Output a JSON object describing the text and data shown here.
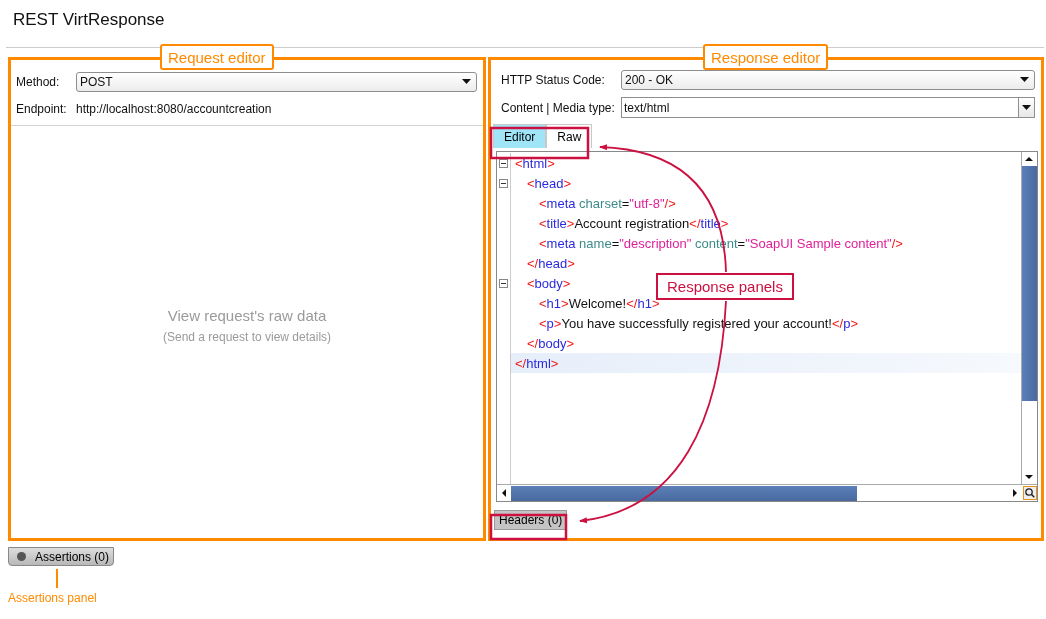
{
  "window": {
    "title": "REST VirtResponse"
  },
  "request_editor": {
    "callout": "Request editor",
    "method": {
      "label": "Method:",
      "value": "POST"
    },
    "endpoint": {
      "label": "Endpoint:",
      "value": "http://localhost:8080/accountcreation"
    },
    "empty_state": {
      "title": "View request's raw data",
      "hint": "(Send a request to view details)"
    }
  },
  "response_editor": {
    "callout": "Response editor",
    "status_code": {
      "label": "HTTP Status Code:",
      "value": "200 - OK"
    },
    "media_type": {
      "label": "Content | Media type:",
      "value": "text/html"
    },
    "tabs": [
      {
        "label": "Editor",
        "selected": true
      },
      {
        "label": "Raw",
        "selected": false
      }
    ],
    "code": [
      {
        "foldable": true,
        "current": false,
        "tokens": [
          {
            "kind": "bracket",
            "text": "<"
          },
          {
            "kind": "tag",
            "text": "html"
          },
          {
            "kind": "bracket",
            "text": ">"
          }
        ],
        "children": [
          {
            "foldable": true,
            "current": false,
            "tokens": [
              {
                "kind": "bracket",
                "text": "<"
              },
              {
                "kind": "tag",
                "text": "head"
              },
              {
                "kind": "bracket",
                "text": ">"
              }
            ],
            "children": [
              {
                "foldable": false,
                "current": false,
                "tokens": [
                  {
                    "kind": "bracket",
                    "text": "<"
                  },
                  {
                    "kind": "tag",
                    "text": "meta "
                  },
                  {
                    "kind": "attr",
                    "text": "charset"
                  },
                  {
                    "kind": "text",
                    "text": "="
                  },
                  {
                    "kind": "value",
                    "text": "\"utf-8\""
                  },
                  {
                    "kind": "bracket",
                    "text": "/>"
                  }
                ]
              },
              {
                "foldable": false,
                "current": false,
                "tokens": [
                  {
                    "kind": "bracket",
                    "text": "<"
                  },
                  {
                    "kind": "tag",
                    "text": "title"
                  },
                  {
                    "kind": "bracket",
                    "text": ">"
                  },
                  {
                    "kind": "text",
                    "text": "Account registration"
                  },
                  {
                    "kind": "bracket",
                    "text": "</"
                  },
                  {
                    "kind": "tag",
                    "text": "title"
                  },
                  {
                    "kind": "bracket",
                    "text": ">"
                  }
                ]
              },
              {
                "foldable": false,
                "current": false,
                "tokens": [
                  {
                    "kind": "bracket",
                    "text": "<"
                  },
                  {
                    "kind": "tag",
                    "text": "meta "
                  },
                  {
                    "kind": "attr",
                    "text": "name"
                  },
                  {
                    "kind": "text",
                    "text": "="
                  },
                  {
                    "kind": "value",
                    "text": "\"description\" "
                  },
                  {
                    "kind": "attr",
                    "text": "content"
                  },
                  {
                    "kind": "text",
                    "text": "="
                  },
                  {
                    "kind": "value",
                    "text": "\"SoapUI Sample content\""
                  },
                  {
                    "kind": "bracket",
                    "text": "/>"
                  }
                ]
              }
            ]
          },
          {
            "foldable": false,
            "current": false,
            "tokens": [
              {
                "kind": "bracket",
                "text": "</"
              },
              {
                "kind": "tag",
                "text": "head"
              },
              {
                "kind": "bracket",
                "text": ">"
              }
            ]
          },
          {
            "foldable": true,
            "current": false,
            "tokens": [
              {
                "kind": "bracket",
                "text": "<"
              },
              {
                "kind": "tag",
                "text": "body"
              },
              {
                "kind": "bracket",
                "text": ">"
              }
            ],
            "children": [
              {
                "foldable": false,
                "current": false,
                "tokens": [
                  {
                    "kind": "bracket",
                    "text": "<"
                  },
                  {
                    "kind": "tag",
                    "text": "h1"
                  },
                  {
                    "kind": "bracket",
                    "text": ">"
                  },
                  {
                    "kind": "text",
                    "text": "Welcome!"
                  },
                  {
                    "kind": "bracket",
                    "text": "</"
                  },
                  {
                    "kind": "tag",
                    "text": "h1"
                  },
                  {
                    "kind": "bracket",
                    "text": ">"
                  }
                ]
              },
              {
                "foldable": false,
                "current": false,
                "tokens": [
                  {
                    "kind": "bracket",
                    "text": "<"
                  },
                  {
                    "kind": "tag",
                    "text": "p"
                  },
                  {
                    "kind": "bracket",
                    "text": ">"
                  },
                  {
                    "kind": "text",
                    "text": "You have successfully registered your account!"
                  },
                  {
                    "kind": "bracket",
                    "text": "</"
                  },
                  {
                    "kind": "tag",
                    "text": "p"
                  },
                  {
                    "kind": "bracket",
                    "text": ">"
                  }
                ]
              }
            ]
          },
          {
            "foldable": false,
            "current": false,
            "tokens": [
              {
                "kind": "bracket",
                "text": "</"
              },
              {
                "kind": "tag",
                "text": "body"
              },
              {
                "kind": "bracket",
                "text": ">"
              }
            ]
          }
        ]
      },
      {
        "foldable": false,
        "current": true,
        "tokens": [
          {
            "kind": "bracket",
            "text": "</"
          },
          {
            "kind": "tag",
            "text": "html"
          },
          {
            "kind": "bracket",
            "text": ">"
          }
        ]
      }
    ],
    "bottom_tabs": [
      {
        "label": "Headers (0)"
      }
    ]
  },
  "assertions_tab": {
    "label": "Assertions (0)"
  },
  "callouts": {
    "response_panels": "Response panels",
    "assertions_panel": "Assertions panel"
  }
}
